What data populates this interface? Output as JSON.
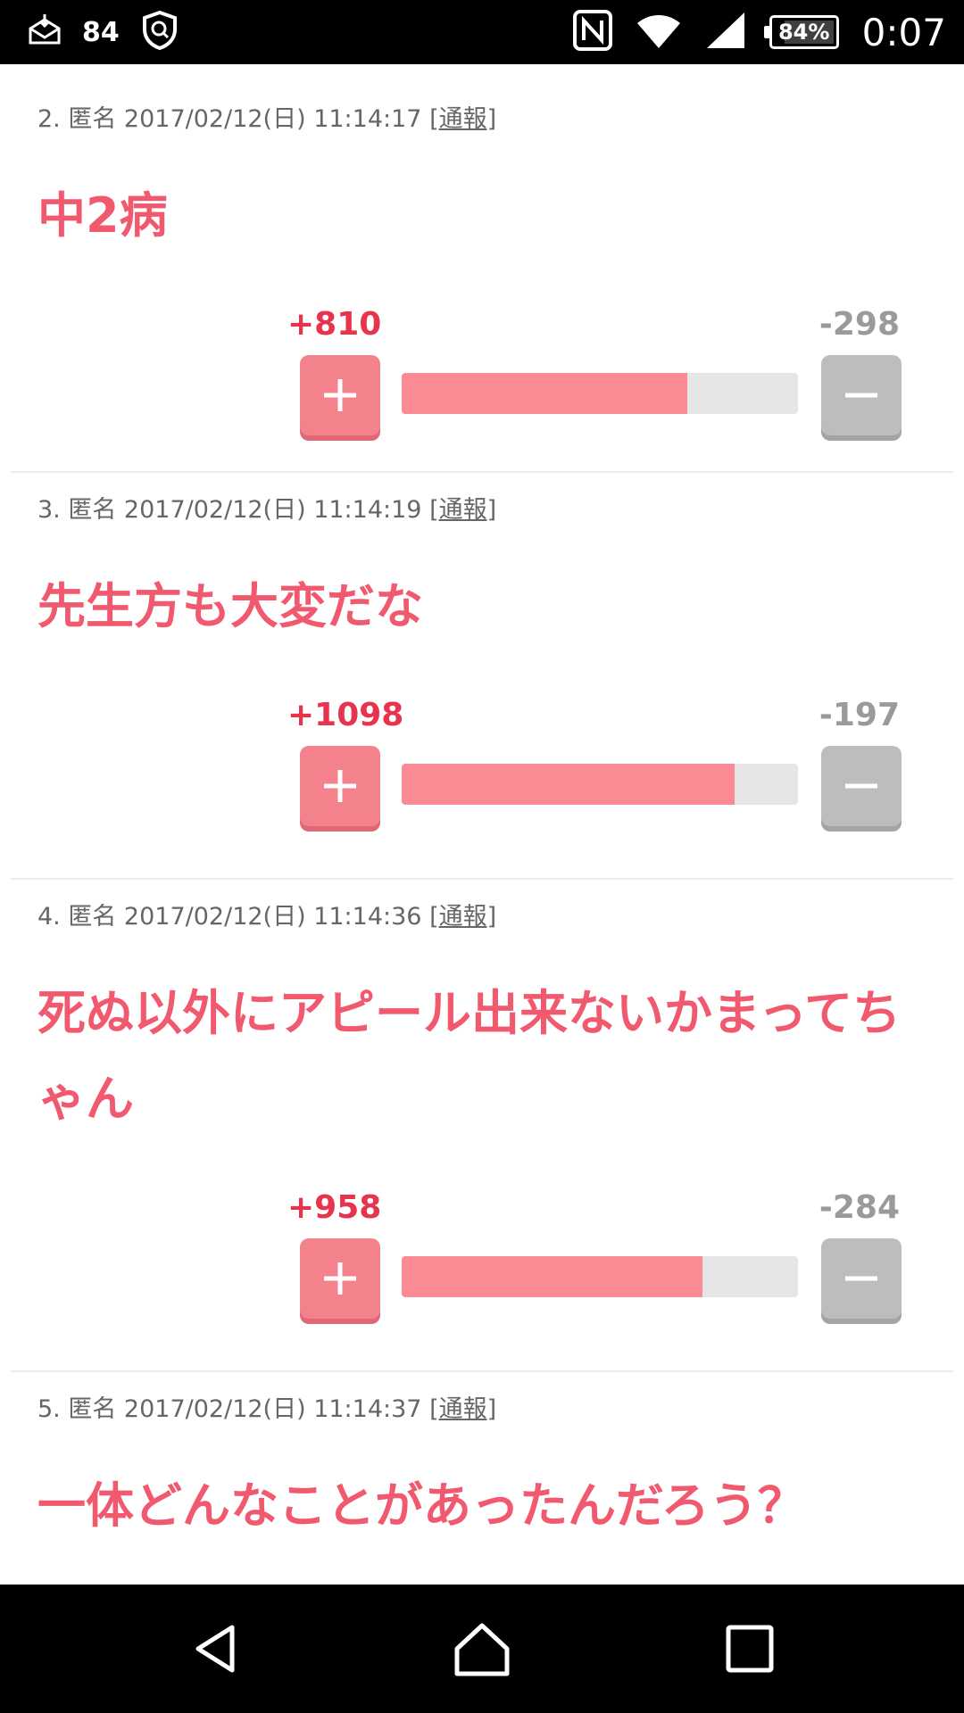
{
  "status_bar": {
    "notification_count": "84",
    "battery_text": "84%",
    "battery_level": 0.84,
    "time": "0:07",
    "icons": [
      "mail-down-icon",
      "shield-search-icon",
      "nfc-icon",
      "wifi-icon",
      "signal-icon",
      "battery-icon"
    ]
  },
  "comments": [
    {
      "meta": "2. 匿名 2017/02/12(日) 11:14:17",
      "report": "[通報]",
      "text": "中2病",
      "plus": "+810",
      "minus": "-298",
      "ratio": 0.72
    },
    {
      "meta": "3. 匿名 2017/02/12(日) 11:14:19",
      "report": "[通報]",
      "text": "先生方も大変だな",
      "plus": "+1098",
      "minus": "-197",
      "ratio": 0.84
    },
    {
      "meta": "4. 匿名 2017/02/12(日) 11:14:36",
      "report": "[通報]",
      "text": "死ぬ以外にアピール出来ないかまってちゃん",
      "plus": "+958",
      "minus": "-284",
      "ratio": 0.76
    },
    {
      "meta": "5. 匿名 2017/02/12(日) 11:14:37",
      "report": "[通報]",
      "text": "一体どんなことがあったんだろう？"
    }
  ],
  "colors": {
    "accent_text": "#f0596e",
    "plus_count": "#e8334d",
    "bar_fill": "#fb8a95",
    "plus_button": "#f4828d",
    "minus_button": "#bdbdbd"
  }
}
